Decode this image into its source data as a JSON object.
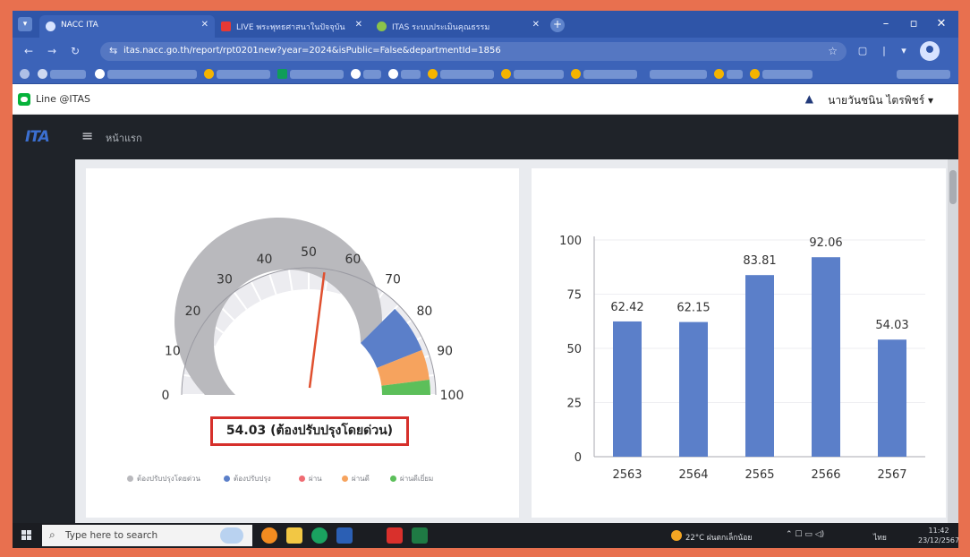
{
  "browser": {
    "tabs": [
      {
        "label": "NACC ITA",
        "active": true
      },
      {
        "label": "LIVE พระพุทธศาสนาในปัจจุบัน",
        "active": false
      },
      {
        "label": "ITAS ระบบประเมินคุณธรรม",
        "active": false
      }
    ],
    "url": "itas.nacc.go.th/report/rpt0201new?year=2024&isPublic=False&departmentId=1856"
  },
  "site": {
    "line_label": "Line @ITAS",
    "user_name": "นายวันชนิน ไตรพิชร์ ▾",
    "nav_home": "หน้าแรก",
    "logo": "ITA"
  },
  "gauge": {
    "value": 54.03,
    "max": 100,
    "ticks": [
      "0",
      "10",
      "20",
      "30",
      "40",
      "50",
      "60",
      "70",
      "80",
      "90",
      "100"
    ],
    "result_label": "54.03 (ต้องปรับปรุงโดยด่วน)",
    "bands": [
      {
        "label": "ต้องปรับปรุงโดยด่วน",
        "from": 0,
        "to": 75,
        "color": "#b9b9bd"
      },
      {
        "label": "ต้องปรับปรุง",
        "from": 75,
        "to": 88,
        "color": "#5b7fc9"
      },
      {
        "label": "ผ่าน",
        "from": 88,
        "to": 88,
        "color": "#ef6b72"
      },
      {
        "label": "ผ่านดี",
        "from": 88,
        "to": 96,
        "color": "#f6a35e"
      },
      {
        "label": "ผ่านดีเยี่ยม",
        "from": 96,
        "to": 100,
        "color": "#5cbf5a"
      }
    ],
    "needle_color": "#e0502f"
  },
  "chart_data": {
    "type": "bar",
    "categories": [
      "2563",
      "2564",
      "2565",
      "2566",
      "2567"
    ],
    "values": [
      62.42,
      62.15,
      83.81,
      92.06,
      54.03
    ],
    "yticks": [
      "0",
      "25",
      "50",
      "75",
      "100"
    ],
    "ylim": [
      0,
      100
    ],
    "color": "#5b7fc9",
    "title": "",
    "xlabel": "",
    "ylabel": ""
  },
  "taskbar": {
    "search_placeholder": "Type here to search",
    "weather": "22°C ฝนตกเล็กน้อย",
    "tray_lang": "ไทย",
    "time": "11:42",
    "date": "23/12/2567"
  }
}
